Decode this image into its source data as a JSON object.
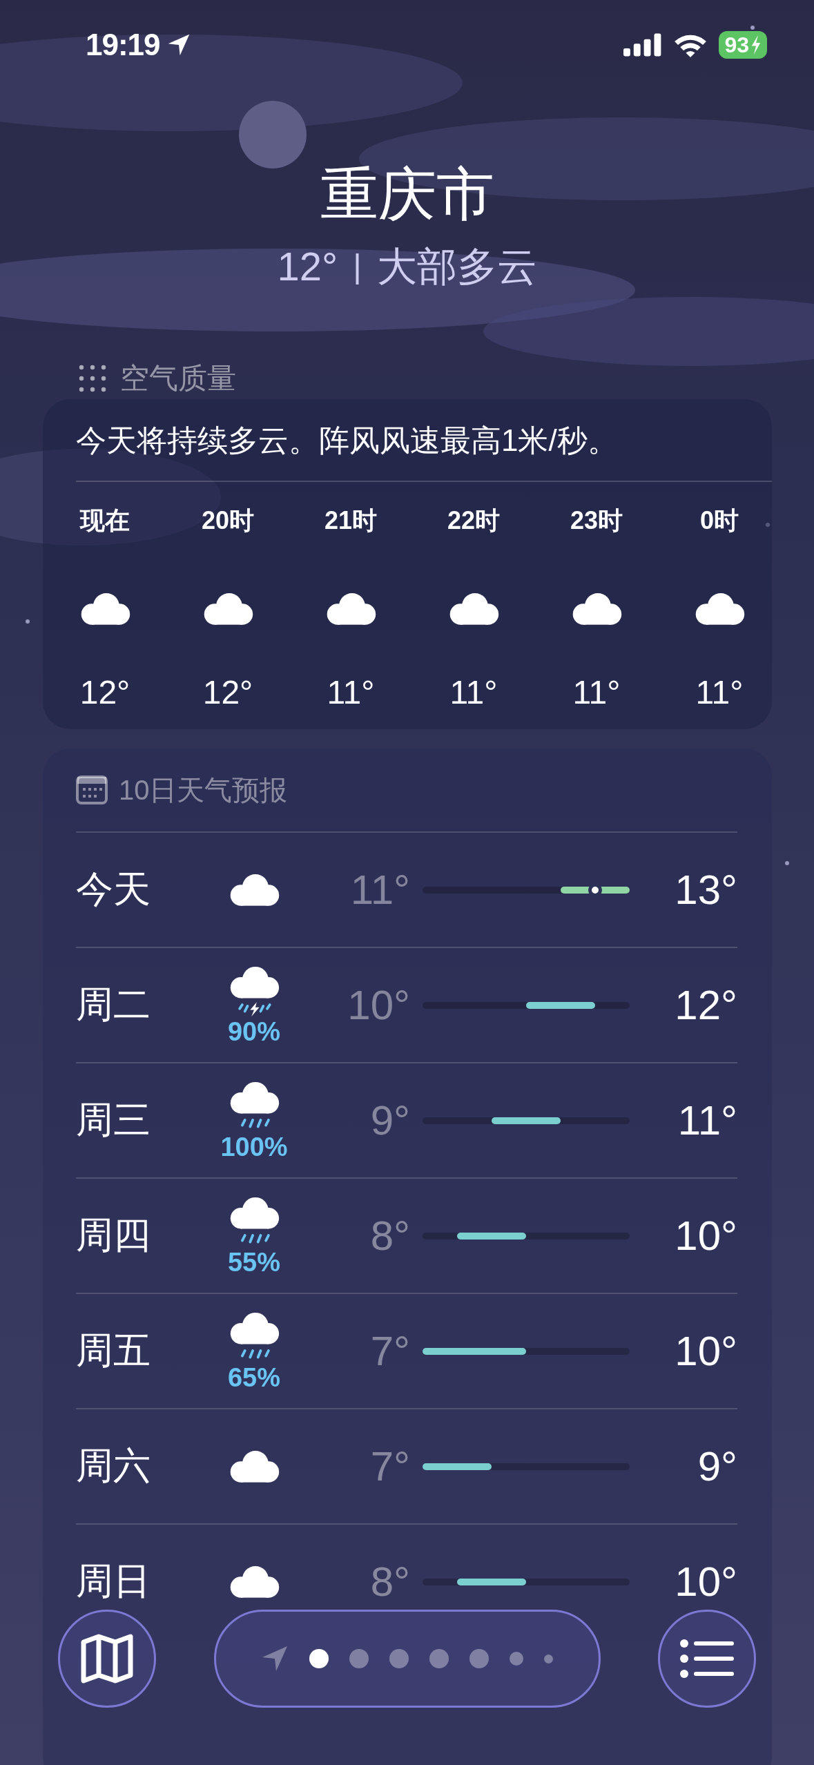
{
  "status_bar": {
    "time": "19:19",
    "battery": "93",
    "charging": true
  },
  "location": {
    "city": "重庆市",
    "temperature": "12°",
    "separator": "|",
    "condition": "大部多云"
  },
  "air_quality": {
    "title": "空气质量"
  },
  "hourly": {
    "summary": "今天将持续多云。阵风风速最高1米/秒。",
    "hours": [
      {
        "time": "现在",
        "kind": "cloud",
        "temp": "12°"
      },
      {
        "time": "20时",
        "kind": "cloud",
        "temp": "12°"
      },
      {
        "time": "21时",
        "kind": "cloud",
        "temp": "11°"
      },
      {
        "time": "22时",
        "kind": "cloud",
        "temp": "11°"
      },
      {
        "time": "23时",
        "kind": "cloud",
        "temp": "11°"
      },
      {
        "time": "0时",
        "kind": "cloud",
        "temp": "11°"
      }
    ]
  },
  "forecast": {
    "title": "10日天气预报",
    "days": [
      {
        "day": "今天",
        "kind": "cloud",
        "low": "11°",
        "high": "13°",
        "current_marker": true
      },
      {
        "day": "周二",
        "kind": "thunder-rain",
        "precipitation": "90%",
        "low": "10°",
        "high": "12°",
        "current_marker": false
      },
      {
        "day": "周三",
        "kind": "rain",
        "precipitation": "100%",
        "low": "9°",
        "high": "11°",
        "current_marker": false
      },
      {
        "day": "周四",
        "kind": "rain",
        "precipitation": "55%",
        "low": "8°",
        "high": "10°",
        "current_marker": false
      },
      {
        "day": "周五",
        "kind": "rain",
        "precipitation": "65%",
        "low": "7°",
        "high": "10°",
        "current_marker": false
      },
      {
        "day": "周六",
        "kind": "cloud",
        "low": "7°",
        "high": "9°",
        "current_marker": false
      },
      {
        "day": "周日",
        "kind": "cloud",
        "low": "8°",
        "high": "10°",
        "current_marker": false
      }
    ]
  },
  "pages": [
    {
      "kind": "location",
      "selected": false
    },
    {
      "kind": "dot",
      "selected": true
    },
    {
      "kind": "dot",
      "selected": false
    },
    {
      "kind": "dot",
      "selected": false
    },
    {
      "kind": "dot",
      "selected": false
    },
    {
      "kind": "dot",
      "selected": false
    },
    {
      "kind": "small-dot",
      "selected": false
    },
    {
      "kind": "tiny-dot",
      "selected": false
    }
  ]
}
